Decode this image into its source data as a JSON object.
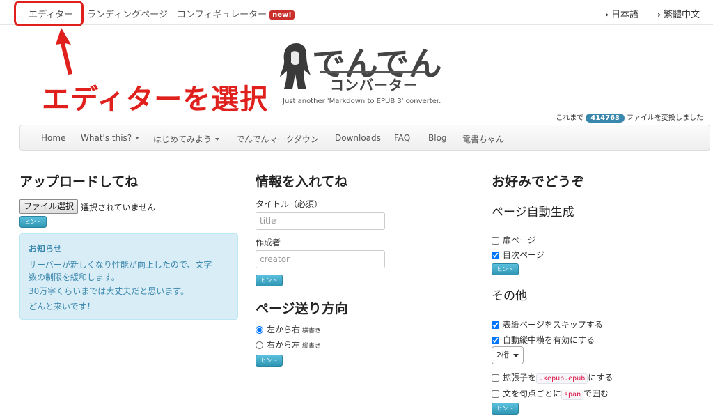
{
  "topnav": {
    "editor": "エディター",
    "landing": "ランディングページ",
    "configurator": "コンフィギュレーター",
    "new_badge": "new!"
  },
  "lang": {
    "ja": "日本語",
    "zh": "繁體中文"
  },
  "annotation": {
    "text": "エディターを選択"
  },
  "logo": {
    "title": "でんでん",
    "subtitle": "コンバーター",
    "tagline": "Just another 'Markdown to EPUB 3' converter."
  },
  "counter": {
    "prefix": "これまで",
    "count": "414763",
    "suffix": "ファイルを変換しました"
  },
  "navbar": {
    "items": [
      "Home",
      "What's this?",
      "はじめてみよう",
      "でんでんマークダウン",
      "Downloads",
      "FAQ",
      "Blog",
      "電書ちゃん"
    ]
  },
  "upload": {
    "heading": "アップロードしてね",
    "file_button": "ファイル選択",
    "file_status": "選択されていません",
    "hint": "ヒント"
  },
  "notice": {
    "title": "お知らせ",
    "lines": [
      "サーバーが新しくなり性能が向上したので、文字",
      "数の制限を緩和します。",
      "30万字くらいまでは大丈夫だと思います。",
      "どんと来いです！"
    ]
  },
  "info": {
    "heading": "情報を入れてね",
    "title_label": "タイトル（必須）",
    "title_placeholder": "title",
    "creator_label": "作成者",
    "creator_placeholder": "creator",
    "hint": "ヒント"
  },
  "direction": {
    "heading": "ページ送り方向",
    "ltr": "左から右",
    "ltr_note": "横書き",
    "rtl": "右から左",
    "rtl_note": "縦書き",
    "hint": "ヒント"
  },
  "prefs": {
    "heading": "お好みでどうぞ",
    "autogen_heading": "ページ自動生成",
    "cover_page": "扉ページ",
    "toc_page": "目次ページ",
    "hint1": "ヒント",
    "other_heading": "その他",
    "skip_cover": "表紙ページをスキップする",
    "tcy": "自動縦中横を有効にする",
    "digits": "2桁",
    "ext_prefix": "拡張子を",
    "ext_code": ".kepub.epub",
    "ext_suffix": "にする",
    "span_prefix": "文を句点ごとに",
    "span_code": "span",
    "span_suffix": "で囲む",
    "hint2": "ヒント"
  }
}
